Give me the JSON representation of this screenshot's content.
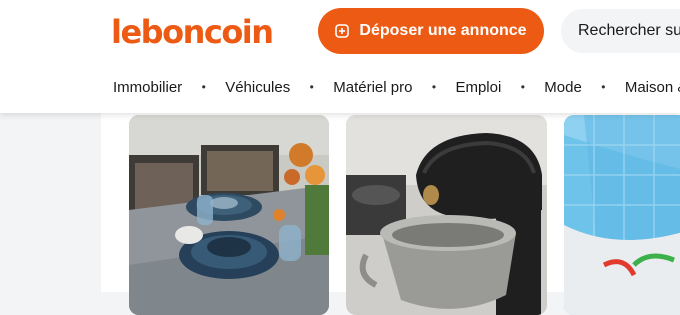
{
  "header": {
    "logo": "leboncoin",
    "deposit_button": {
      "label": "Déposer une annonce",
      "icon": "plus-square-icon"
    },
    "search": {
      "placeholder": "Rechercher sur leboncoin"
    }
  },
  "nav": {
    "items": [
      {
        "label": "Immobilier"
      },
      {
        "label": "Véhicules"
      },
      {
        "label": "Matériel pro"
      },
      {
        "label": "Emploi"
      },
      {
        "label": "Mode"
      },
      {
        "label": "Maison & Jardin"
      }
    ],
    "separator": "•"
  },
  "colors": {
    "brand": "#ec5a13",
    "background": "#f2f4f6"
  }
}
